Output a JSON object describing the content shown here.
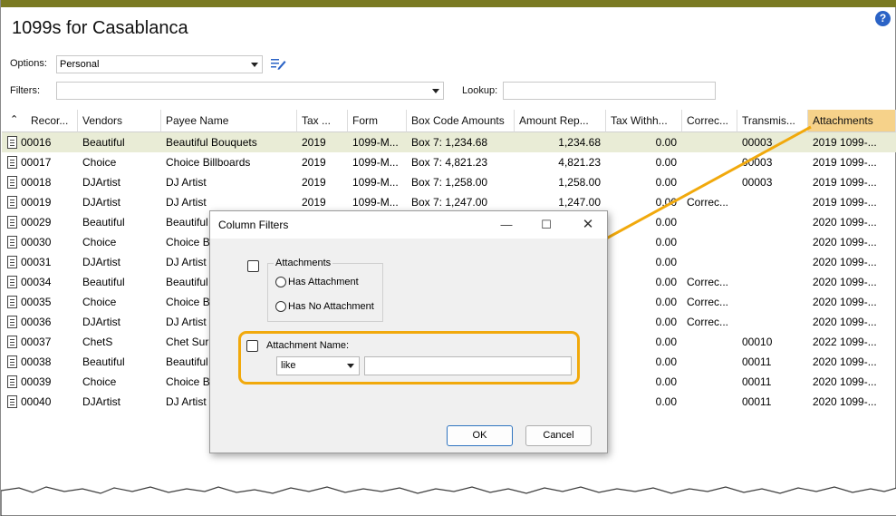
{
  "app": {
    "title": "1099s for Casablanca",
    "options_label": "Options:",
    "options_value": "Personal",
    "filters_label": "Filters:",
    "filters_value": "",
    "lookup_label": "Lookup:",
    "lookup_value": ""
  },
  "grid": {
    "columns": [
      "Recor...",
      "Vendors",
      "Payee Name",
      "Tax ...",
      "Form",
      "Box Code Amounts",
      "Amount Rep...",
      "Tax Withh...",
      "Correc...",
      "Transmis...",
      "Attachments"
    ],
    "rows": [
      [
        "00016",
        "Beautiful",
        "Beautiful Bouquets",
        "2019",
        "1099-M...",
        "Box 7: 1,234.68",
        "1,234.68",
        "0.00",
        "",
        "00003",
        "2019 1099-..."
      ],
      [
        "00017",
        "Choice",
        "Choice Billboards",
        "2019",
        "1099-M...",
        "Box 7: 4,821.23",
        "4,821.23",
        "0.00",
        "",
        "00003",
        "2019 1099-..."
      ],
      [
        "00018",
        "DJArtist",
        "DJ Artist",
        "2019",
        "1099-M...",
        "Box 7: 1,258.00",
        "1,258.00",
        "0.00",
        "",
        "00003",
        "2019 1099-..."
      ],
      [
        "00019",
        "DJArtist",
        "DJ Artist",
        "2019",
        "1099-M...",
        "Box 7: 1,247.00",
        "1,247.00",
        "0.00",
        "Correc...",
        "",
        "2019 1099-..."
      ],
      [
        "00029",
        "Beautiful",
        "Beautiful",
        "",
        "",
        "",
        "",
        "0.00",
        "",
        "",
        "2020 1099-..."
      ],
      [
        "00030",
        "Choice",
        "Choice B",
        "",
        "",
        "",
        "",
        "0.00",
        "",
        "",
        "2020 1099-..."
      ],
      [
        "00031",
        "DJArtist",
        "DJ Artist",
        "",
        "",
        "",
        "",
        "0.00",
        "",
        "",
        "2020 1099-..."
      ],
      [
        "00034",
        "Beautiful",
        "Beautiful",
        "",
        "",
        "",
        "",
        "0.00",
        "Correc...",
        "",
        "2020 1099-..."
      ],
      [
        "00035",
        "Choice",
        "Choice B",
        "",
        "",
        "",
        "",
        "0.00",
        "Correc...",
        "",
        "2020 1099-..."
      ],
      [
        "00036",
        "DJArtist",
        "DJ Artist",
        "",
        "",
        "",
        "",
        "0.00",
        "Correc...",
        "",
        "2020 1099-..."
      ],
      [
        "00037",
        "ChetS",
        "Chet Sur",
        "",
        "",
        "",
        "",
        "0.00",
        "",
        "00010",
        "2022 1099-..."
      ],
      [
        "00038",
        "Beautiful",
        "Beautiful",
        "",
        "",
        "",
        "",
        "0.00",
        "",
        "00011",
        "2020 1099-..."
      ],
      [
        "00039",
        "Choice",
        "Choice B",
        "",
        "",
        "",
        "",
        "0.00",
        "",
        "00011",
        "2020 1099-..."
      ],
      [
        "00040",
        "DJArtist",
        "DJ Artist",
        "",
        "",
        "",
        "",
        "0.00",
        "",
        "00011",
        "2020 1099-..."
      ]
    ]
  },
  "dialog": {
    "title": "Column Filters",
    "attachments_group": "Attachments",
    "has_attachment": "Has Attachment",
    "has_no_attachment": "Has No Attachment",
    "attachment_name_label": "Attachment Name:",
    "operator_value": "like",
    "name_value": "",
    "ok_label": "OK",
    "cancel_label": "Cancel"
  },
  "icons": {
    "help": "help-icon",
    "edit": "edit-list-icon",
    "sort": "sort-up-icon",
    "record": "document-icon",
    "minimize": "minimize-icon",
    "maximize": "maximize-icon",
    "close": "close-icon"
  },
  "colors": {
    "topbar": "#7a7a22",
    "selected_row": "#e9ecd6",
    "attachments_header": "#f6d28a",
    "highlight": "#f1a90c",
    "help": "#2b63c6"
  }
}
